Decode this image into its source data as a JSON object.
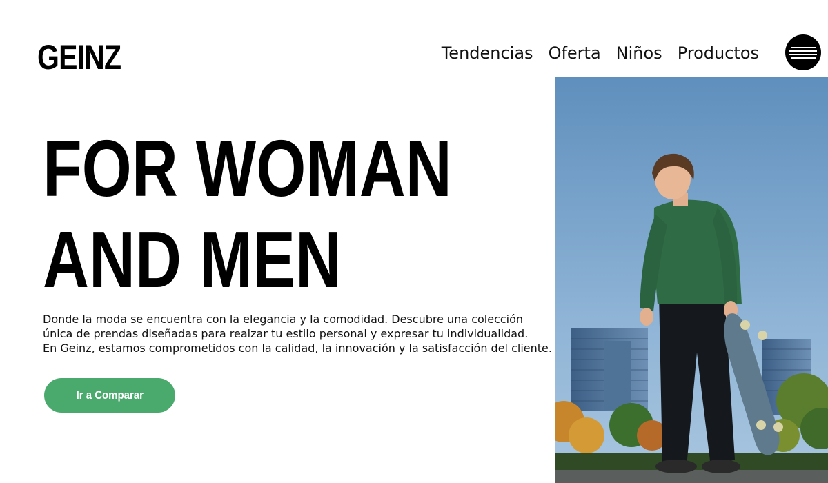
{
  "brand": {
    "name": "GEINZ"
  },
  "nav": {
    "items": [
      {
        "label": "Tendencias"
      },
      {
        "label": "Oferta"
      },
      {
        "label": "Niños"
      },
      {
        "label": "Productos"
      }
    ],
    "menu_icon": "hamburger-icon"
  },
  "hero": {
    "headline_lines": [
      "FOR WOMAN",
      "AND MEN"
    ],
    "description_lines": [
      "Donde la moda se encuentra con la elegancia y la comodidad. Descubre una colección",
      "única de prendas diseñadas para realzar tu estilo personal y expresar tu individualidad.",
      "En Geinz, estamos comprometidos con la calidad, la innovación y la satisfacción del cliente."
    ],
    "cta_label": "Ir a Comparar",
    "image_subject": "skateboarder-photo"
  },
  "colors": {
    "background": "#ffffff",
    "text": "#000000",
    "accent": "#4aa96c",
    "menu_button": "#000000",
    "sky": "#6f9bc2"
  }
}
